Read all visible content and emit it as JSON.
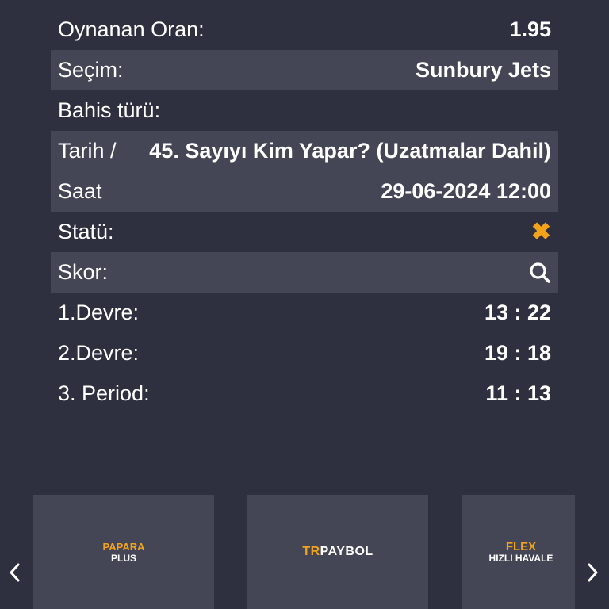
{
  "details": {
    "odds_label": "Oynanan Oran:",
    "odds_value": "1.95",
    "selection_label": "Seçim:",
    "selection_value": "Sunbury Jets",
    "bet_type_label": "Bahis türü:",
    "date_label_1": "Tarih /",
    "date_label_2": "Saat",
    "bet_type_value": "45. Sayıyı Kim Yapar? (Uzatmalar Dahil)",
    "datetime_value": "29-06-2024 12:00",
    "status_label": "Statü:",
    "status_icon": "close-icon",
    "score_label": "Skor:",
    "score_icon": "search-icon",
    "periods": [
      {
        "label": "1.Devre:",
        "score": "13 : 22"
      },
      {
        "label": "2.Devre:",
        "score": "19 : 18"
      },
      {
        "label": "3. Period:",
        "score": "11 : 13"
      }
    ]
  },
  "payment_methods": {
    "papara_top": "PAPARA",
    "papara_bottom": "PLUS",
    "trpaybol_tr": "TR",
    "trpaybol_rest": "PAYBOL",
    "flex_top": "FLEX",
    "flex_bottom": "HIZLI HAVALE"
  },
  "colors": {
    "background": "#2e3040",
    "row_shade": "#444656",
    "accent": "#f2a31b"
  }
}
